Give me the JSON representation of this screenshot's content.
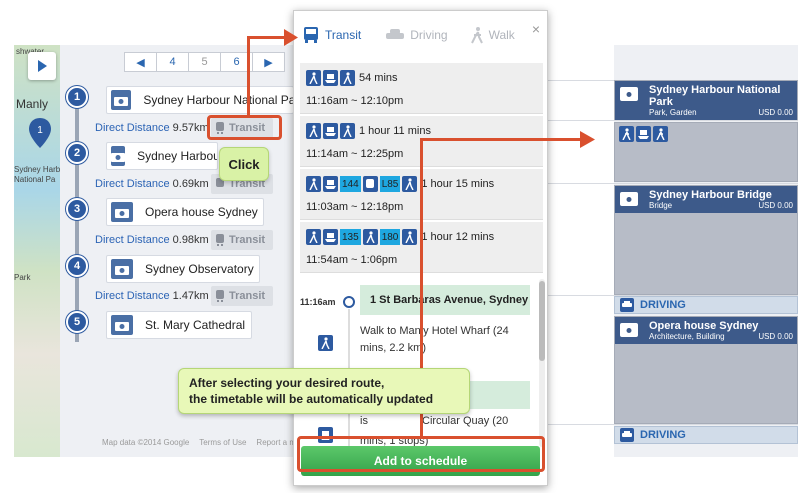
{
  "map": {
    "labels": [
      "shwater",
      "Manly",
      "Sydney Harbour",
      "National Pa",
      "Park"
    ],
    "footer": [
      "Map data ©2014 Google",
      "Terms of Use",
      "Report a map error"
    ]
  },
  "pager": {
    "prev": "◀",
    "pages": [
      "4",
      "5",
      "6"
    ],
    "next": "▶"
  },
  "places": [
    {
      "num": "1",
      "name": "Sydney Harbour National Park"
    },
    {
      "num": "2",
      "name": "Sydney Harbour Bridge"
    },
    {
      "num": "3",
      "name": "Opera house Sydney"
    },
    {
      "num": "4",
      "name": "Sydney Observatory"
    },
    {
      "num": "5",
      "name": "St. Mary Cathedral"
    }
  ],
  "distances": [
    {
      "label": "Direct Distance",
      "value": "9.57km",
      "mode": "Transit"
    },
    {
      "label": "Direct Distance",
      "value": "0.69km",
      "mode": "Transit"
    },
    {
      "label": "Direct Distance",
      "value": "0.98km",
      "mode": "Transit"
    },
    {
      "label": "Direct Distance",
      "value": "1.47km",
      "mode": "Transit"
    }
  ],
  "popup": {
    "tabs": {
      "transit": "Transit",
      "driving": "Driving",
      "walk": "Walk"
    },
    "close": "×",
    "routes": [
      {
        "duration": "54 mins",
        "times": "11:16am ~ 12:10pm"
      },
      {
        "duration": "1 hour 11 mins",
        "times": "11:14am ~ 12:25pm"
      },
      {
        "duration": "1 hour 15 mins",
        "times": "11:03am ~ 12:18pm",
        "buses": [
          "144",
          "L85"
        ]
      },
      {
        "duration": "1 hour 12 mins",
        "times": "11:54am ~ 1:06pm",
        "buses": [
          "135",
          "180"
        ]
      }
    ],
    "detail": {
      "time": "11:16am",
      "stop": "1 St Barbaras Avenue, Sydney",
      "walk": "Walk to Manly Hotel Wharf (24 mins, 2.2 km)",
      "ferry": "Circular Quay (20 mins, 1 stops)",
      "ferry_prefix": "is"
    },
    "add_button": "Add to schedule"
  },
  "right": {
    "items": [
      {
        "title": "Sydney Harbour National Park",
        "category": "Park, Garden",
        "price": "USD 0.00"
      },
      {
        "title": "Sydney Harbour Bridge",
        "category": "Bridge",
        "price": "USD 0.00"
      },
      {
        "title": "Opera house Sydney",
        "category": "Architecture, Building",
        "price": "USD 0.00"
      }
    ],
    "driving": [
      "DRIVING",
      "DRIVING"
    ]
  },
  "annotations": {
    "click": "Click",
    "info_line1": "After selecting your desired route,",
    "info_line2": "the timetable will be automatically updated"
  },
  "colors": {
    "accent": "#2d5aa0",
    "annotation": "#d9502e",
    "button": "#34a24a",
    "callout": "#e8f8b8"
  }
}
